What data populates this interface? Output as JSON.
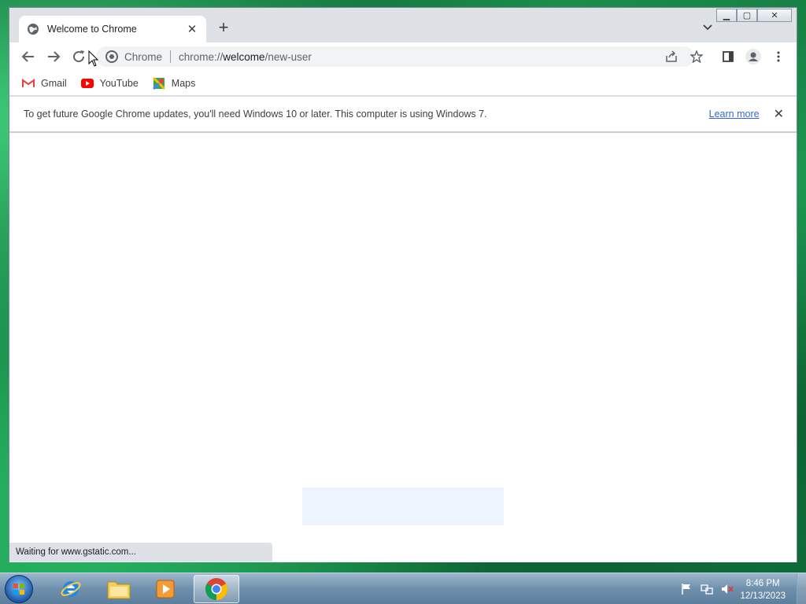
{
  "browser": {
    "tab": {
      "title": "Welcome to Chrome",
      "icon": "globe-icon"
    },
    "omnibox": {
      "site_label": "Chrome",
      "url_prefix": "chrome://",
      "url_host": "welcome",
      "url_path": "/new-user"
    },
    "bookmarks": [
      {
        "label": "Gmail",
        "icon": "gmail-icon"
      },
      {
        "label": "YouTube",
        "icon": "youtube-icon"
      },
      {
        "label": "Maps",
        "icon": "maps-icon"
      }
    ],
    "infobar": {
      "message": "To get future Google Chrome updates, you'll need Windows 10 or later. This computer is using Windows 7.",
      "link": "Learn more"
    },
    "status": "Waiting for www.gstatic.com..."
  },
  "taskbar": {
    "time": "8:46 PM",
    "date": "12/13/2023",
    "apps": [
      "internet-explorer-icon",
      "file-explorer-icon",
      "media-player-icon",
      "chrome-icon"
    ]
  },
  "colors": {
    "accent": "#1a73e8",
    "chrome_bg": "#dee1e6",
    "link": "#3367d6"
  }
}
